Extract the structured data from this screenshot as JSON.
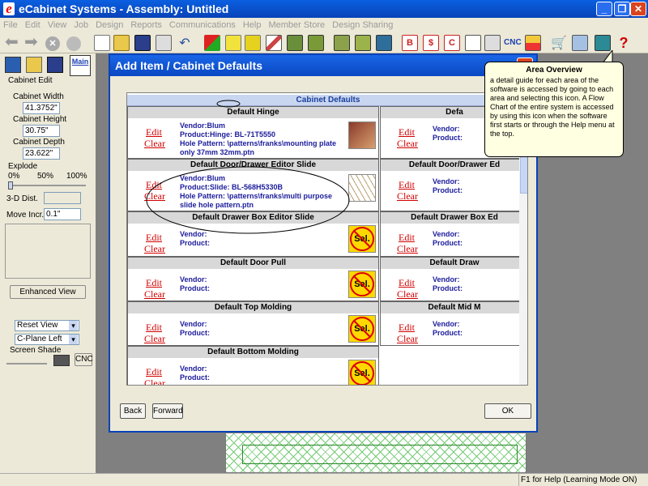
{
  "window": {
    "title": "eCabinet Systems - Assembly: Untitled",
    "logo_letter": "e"
  },
  "menu": [
    "File",
    "Edit",
    "View",
    "Job",
    "Design",
    "Reports",
    "Communications",
    "Help",
    "Member Store",
    "Design Sharing"
  ],
  "toolbar": {
    "cnc_label": "CNC",
    "help_glyph": "?"
  },
  "left_panel": {
    "main_tab": "Main",
    "section_title": "Cabinet Edit",
    "width_label": "Cabinet Width",
    "width_value": "41.3752\"",
    "height_label": "Cabinet Height",
    "height_value": "30.75\"",
    "depth_label": "Cabinet Depth",
    "depth_value": "23.622\"",
    "explode_label": "Explode",
    "explode_ticks": [
      "0%",
      "50%",
      "100%"
    ],
    "dist_label": "3-D Dist.",
    "move_label": "Move Incr.",
    "move_value": "0.1\"",
    "enhanced_button": "Enhanced View",
    "reset_view": "Reset View",
    "cplane": "C-Plane Left",
    "screen_shade": "Screen Shade",
    "cnc_button": "CNC"
  },
  "dialog": {
    "title": "Add Item / Cabinet Defaults",
    "close_glyph": "✕",
    "panel_header": "Cabinet Defaults",
    "edit_label": "Edit",
    "clear_label": "Clear",
    "vendor_label": "Vendor:",
    "product_label": "Product:",
    "sel_label": "Sel.",
    "left_cells": [
      {
        "title": "Default Hinge",
        "vendor": "Vendor:Blum",
        "product": "Product:Hinge: BL-71T5550",
        "pattern": "Hole Pattern: \\patterns\\franks\\mounting plate only 37mm 32mm.ptn"
      },
      {
        "title": "Default Door/Drawer Editor Slide",
        "vendor": "Vendor:Blum",
        "product": "Product:Slide: BL-568H5330B",
        "pattern": "Hole Pattern: \\patterns\\franks\\multi purpose slide hole pattern.ptn"
      },
      {
        "title": "Default Drawer Box Editor Slide"
      },
      {
        "title": "Default Door Pull"
      },
      {
        "title": "Default Top Molding"
      },
      {
        "title": "Default Bottom Molding"
      }
    ],
    "right_cells": [
      {
        "title": "Defa"
      },
      {
        "title": "Default Door/Drawer Ed"
      },
      {
        "title": "Default Drawer Box Ed"
      },
      {
        "title": "Default Draw"
      },
      {
        "title": "Default Mid M"
      }
    ],
    "back_button": "Back",
    "forward_button": "Forward",
    "ok_button": "OK"
  },
  "tooltip": {
    "title": "Area Overview",
    "body": "a detail guide for each area of the software is accessed by going to each area and selecting this icon. A Flow Chart of the entire system is accessed by using this icon when the software first starts or through the Help menu at the top."
  },
  "status": {
    "help_text": "F1 for Help (Learning Mode ON)"
  }
}
